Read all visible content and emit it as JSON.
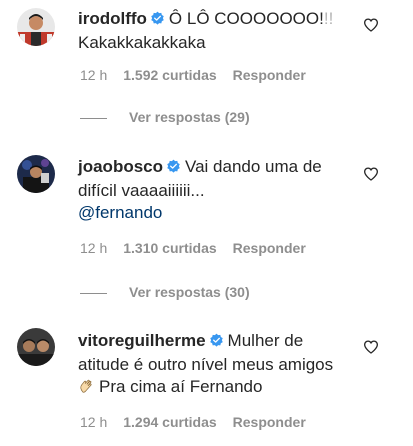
{
  "comments": [
    {
      "username": "irodolffo",
      "text": "Ô LÔ COOOOOOO!",
      "text_faded": "!!",
      "line2": "Kakakkakakkaka",
      "time": "12 h",
      "likes": "1.592 curtidas",
      "reply": "Responder",
      "view_replies": "Ver respostas (29)"
    },
    {
      "username": "joaobosco",
      "text": "Vai dando uma de",
      "line2": "difícil vaaaaiiiiii...",
      "mention": "@fernando",
      "time": "12 h",
      "likes": "1.310 curtidas",
      "reply": "Responder",
      "view_replies": "Ver respostas (30)"
    },
    {
      "username": "vitoreguilherme",
      "text": "Mulher de",
      "line2": "atitude é outro nível meus amigos",
      "line3": "Pra cima aí Fernando",
      "time": "12 h",
      "likes": "1.294 curtidas",
      "reply": "Responder"
    }
  ],
  "icons": {
    "verified": "verified-badge-icon",
    "like": "heart-outline-icon",
    "emoji": "clapping-hands-icon"
  },
  "colors": {
    "verified_blue": "#3897f0",
    "text": "#262626",
    "meta": "#8e8e8e",
    "mention": "#00376b"
  }
}
